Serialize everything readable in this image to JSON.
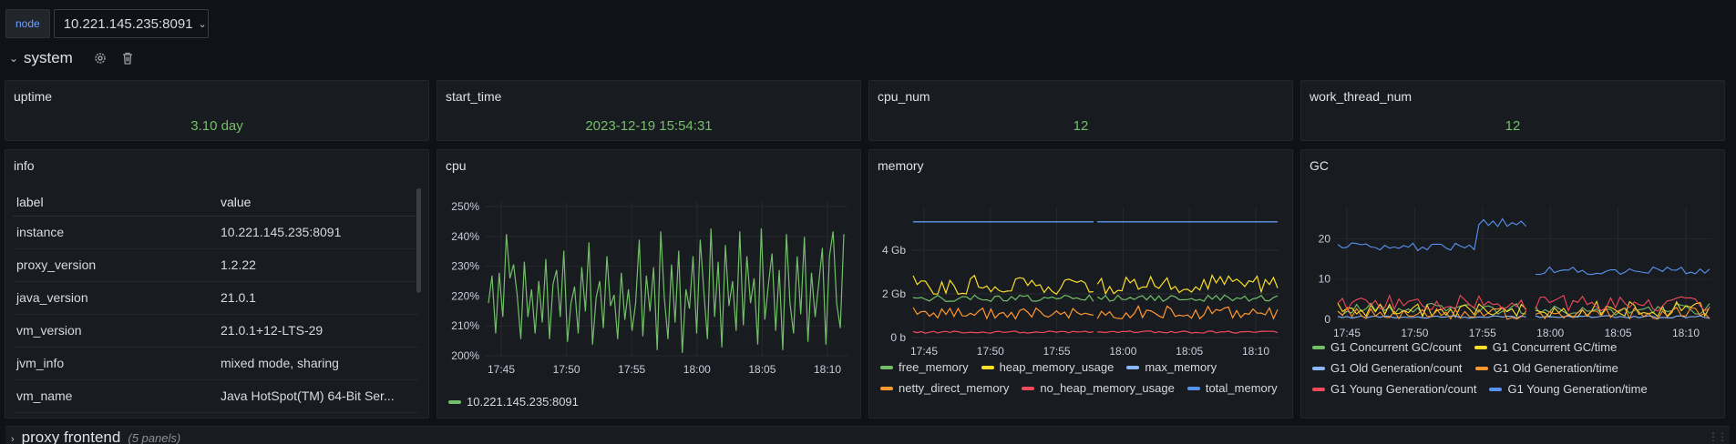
{
  "variables": {
    "label": "node",
    "value": "10.221.145.235:8091"
  },
  "row": {
    "title": "system"
  },
  "collapsed_row": {
    "title": "proxy frontend",
    "subtitle": "(5 panels)"
  },
  "stats": {
    "uptime": {
      "title": "uptime",
      "value": "3.10 day"
    },
    "start_time": {
      "title": "start_time",
      "value": "2023-12-19 15:54:31"
    },
    "cpu_num": {
      "title": "cpu_num",
      "value": "12"
    },
    "work_thread_num": {
      "title": "work_thread_num",
      "value": "12"
    }
  },
  "info": {
    "title": "info",
    "columns": [
      "label",
      "value"
    ],
    "rows": [
      [
        "instance",
        "10.221.145.235:8091"
      ],
      [
        "proxy_version",
        "1.2.22"
      ],
      [
        "java_version",
        "21.0.1"
      ],
      [
        "vm_version",
        "21.0.1+12-LTS-29"
      ],
      [
        "jvm_info",
        "mixed mode, sharing"
      ],
      [
        "vm_name",
        "Java HotSpot(TM) 64-Bit Ser..."
      ]
    ]
  },
  "colors": {
    "green": "#73bf69",
    "yellow": "#fade2a",
    "blue": "#8ab8ff",
    "orange": "#ff9830",
    "red": "#f2495c",
    "darkblue": "#5794f2"
  },
  "chart_data": [
    {
      "type": "line",
      "title": "cpu",
      "x_ticks": [
        "17:45",
        "17:50",
        "17:55",
        "18:00",
        "18:05",
        "18:10"
      ],
      "y_ticks": [
        "250%",
        "240%",
        "230%",
        "220%",
        "210%",
        "200%"
      ],
      "ylim": [
        198,
        252
      ],
      "series": [
        {
          "name": "10.221.145.235:8091",
          "color": "#73bf69",
          "values": [
            219,
            229,
            208,
            230,
            214,
            244,
            228,
            233,
            222,
            206,
            234,
            214,
            224,
            208,
            227,
            212,
            235,
            206,
            226,
            231,
            214,
            238,
            205,
            219,
            225,
            208,
            232,
            216,
            241,
            204,
            221,
            227,
            210,
            236,
            218,
            222,
            206,
            230,
            213,
            224,
            209,
            219,
            242,
            207,
            229,
            216,
            232,
            202,
            245,
            221,
            206,
            233,
            212,
            238,
            201,
            224,
            217,
            236,
            208,
            242,
            223,
            206,
            246,
            214,
            234,
            203,
            240,
            218,
            227,
            209,
            245,
            211,
            236,
            219,
            228,
            204,
            246,
            213,
            226,
            237,
            209,
            231,
            202,
            244,
            219,
            208,
            236,
            215,
            243,
            205,
            230,
            214,
            226,
            239,
            204,
            236,
            245,
            219,
            210,
            244
          ]
        }
      ]
    },
    {
      "type": "line",
      "title": "memory",
      "x_ticks": [
        "17:45",
        "17:50",
        "17:55",
        "18:00",
        "18:05",
        "18:10"
      ],
      "y_ticks": [
        "4 Gb",
        "2 Gb",
        "0 b"
      ],
      "ylim": [
        0,
        6
      ],
      "gap_at_fraction": 0.485,
      "series": [
        {
          "name": "free_memory",
          "color": "#73bf69",
          "base": 1.8,
          "amp": 0.15
        },
        {
          "name": "heap_memory_usage",
          "color": "#fade2a",
          "base": 2.4,
          "amp": 0.45
        },
        {
          "name": "max_memory",
          "color": "#8ab8ff",
          "base": 5.3,
          "amp": 0
        },
        {
          "name": "netty_direct_memory",
          "color": "#ff9830",
          "base": 1.15,
          "amp": 0.3
        },
        {
          "name": "no_heap_memory_usage",
          "color": "#f2495c",
          "base": 0.25,
          "amp": 0.05
        },
        {
          "name": "total_memory",
          "color": "#5794f2",
          "base": 5.3,
          "amp": 0
        }
      ]
    },
    {
      "type": "line",
      "title": "GC",
      "x_ticks": [
        "17:45",
        "17:50",
        "17:55",
        "18:00",
        "18:05",
        "18:10"
      ],
      "y_ticks": [
        "20",
        "10",
        "0"
      ],
      "ylim": [
        0,
        28
      ],
      "gap_from": 0.5,
      "gap_to": 0.53,
      "series": [
        {
          "name": "G1 Concurrent GC/count",
          "color": "#73bf69",
          "base": 2.5,
          "amp": 1.5
        },
        {
          "name": "G1 Concurrent GC/time",
          "color": "#fade2a",
          "base": 2.5,
          "amp": 2
        },
        {
          "name": "G1 Old Generation/count",
          "color": "#8ab8ff",
          "base": 0.6,
          "amp": 0.3
        },
        {
          "name": "G1 Old Generation/time",
          "color": "#ff9830",
          "base": 1.5,
          "amp": 1.5
        },
        {
          "name": "G1 Young Generation/count",
          "color": "#f2495c",
          "base": 4,
          "amp": 2
        },
        {
          "name": "G1 Young Generation/time",
          "color": "#5794f2",
          "base": 12,
          "amp": 1
        }
      ]
    }
  ]
}
